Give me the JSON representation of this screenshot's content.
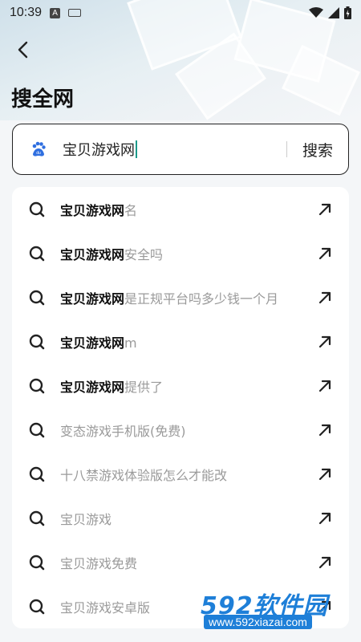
{
  "status_bar": {
    "time": "10:39",
    "indicator_a": "A"
  },
  "header": {
    "title": "搜全网"
  },
  "search": {
    "engine_icon": "baidu-paw-icon",
    "query": "宝贝游戏网",
    "button_label": "搜索"
  },
  "suggestions": [
    {
      "highlight": "宝贝游戏网",
      "rest": "名"
    },
    {
      "highlight": "宝贝游戏网",
      "rest": "安全吗"
    },
    {
      "highlight": "宝贝游戏网",
      "rest": "是正规平台吗多少钱一个月"
    },
    {
      "highlight": "宝贝游戏网",
      "rest": "m"
    },
    {
      "highlight": "宝贝游戏网",
      "rest": "提供了"
    },
    {
      "highlight": "",
      "rest": "变态游戏手机版(免费)"
    },
    {
      "highlight": "",
      "rest": "十八禁游戏体验版怎么才能改"
    },
    {
      "highlight": "",
      "rest": "宝贝游戏"
    },
    {
      "highlight": "",
      "rest": "宝贝游戏免费"
    },
    {
      "highlight": "",
      "rest": "宝贝游戏安卓版"
    }
  ],
  "watermark": {
    "brand": "592软件园",
    "url": "www.592xiazai.com"
  },
  "colors": {
    "accent": "#1e7fd8",
    "caret": "#1a9a8a",
    "muted_text": "#9a9a9a"
  }
}
